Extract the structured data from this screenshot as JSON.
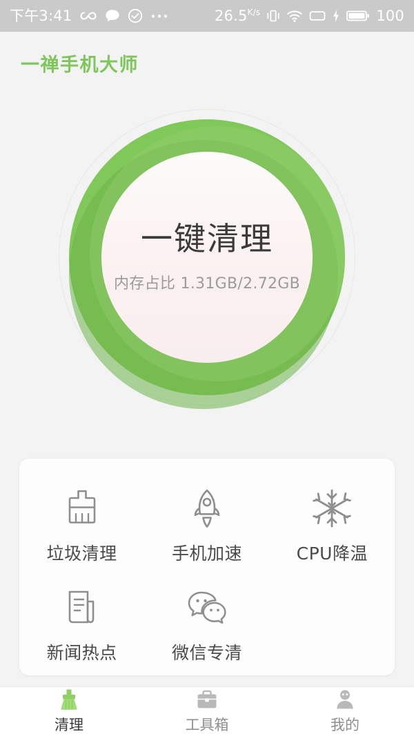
{
  "statusbar": {
    "time": "下午3:41",
    "left_icons": [
      "infinity-icon",
      "chat-bubble-icon",
      "check-circle-icon",
      "more-dots-icon"
    ],
    "network_speed": "26.5",
    "network_speed_unit": "K/s",
    "right_icons": [
      "vibrate-icon",
      "wifi-icon",
      "sim-card-icon",
      "charging-bolt-icon",
      "battery-icon"
    ],
    "battery_level": "100",
    "background_color": "#c9cac9",
    "foreground_color": "#ffffff"
  },
  "header": {
    "app_title": "一禅手机大师",
    "accent_color": "#7ec65a"
  },
  "hero": {
    "button_label": "一键清理",
    "memory_label": "内存占比 1.31GB/2.72GB",
    "memory_used": "1.31GB",
    "memory_total": "2.72GB",
    "ring_color": "#81c85a",
    "inner_color": "#faf0ef"
  },
  "features": {
    "rows": [
      [
        {
          "icon": "broom-icon",
          "label": "垃圾清理"
        },
        {
          "icon": "rocket-icon",
          "label": "手机加速"
        },
        {
          "icon": "snowflake-icon",
          "label": "CPU降温"
        }
      ],
      [
        {
          "icon": "news-icon",
          "label": "新闻热点"
        },
        {
          "icon": "wechat-icon",
          "label": "微信专清"
        },
        {
          "icon": "",
          "label": ""
        }
      ]
    ]
  },
  "tabbar": {
    "items": [
      {
        "icon": "broom-icon",
        "label": "清理",
        "active": true
      },
      {
        "icon": "toolbox-icon",
        "label": "工具箱",
        "active": false
      },
      {
        "icon": "person-icon",
        "label": "我的",
        "active": false
      }
    ],
    "active_color": "#8fd36a",
    "inactive_color": "#b4b4b4"
  }
}
